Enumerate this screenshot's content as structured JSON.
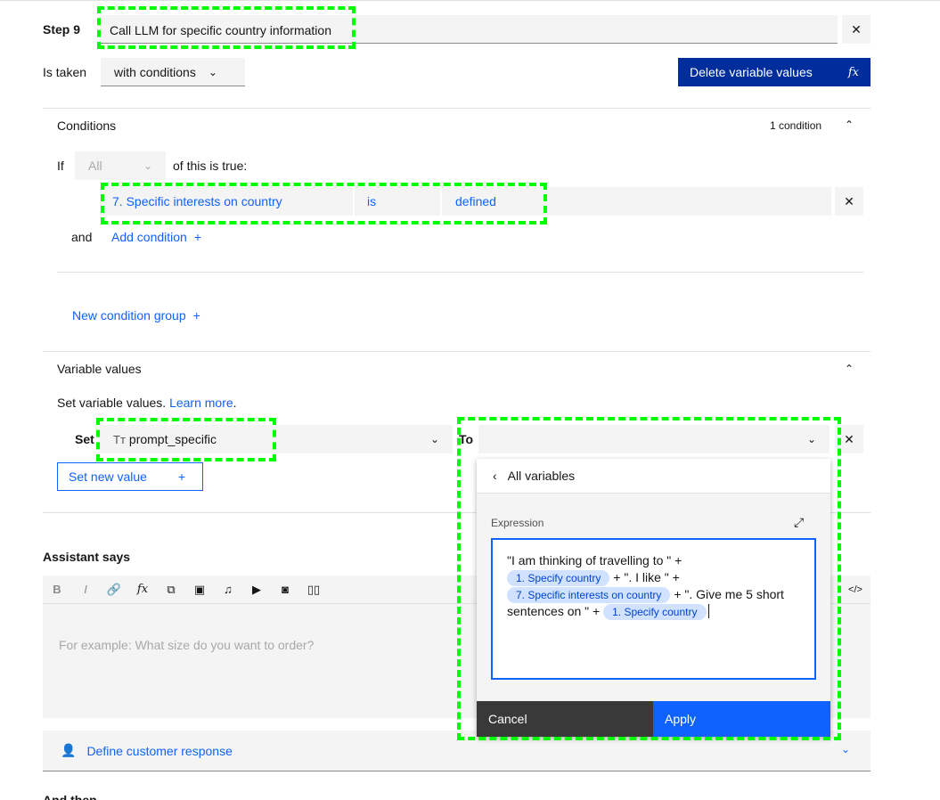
{
  "step": {
    "label": "Step 9",
    "title_value": "Call LLM for specific country information"
  },
  "taken": {
    "label": "Is taken",
    "value": "with conditions"
  },
  "delete_button": {
    "label": "Delete variable values",
    "icon_text": "fx"
  },
  "conditions": {
    "header": "Conditions",
    "count": "1 condition",
    "if_label": "If",
    "all_value": "All",
    "of_this": "of this is true:",
    "row": {
      "variable": "7. Specific interests on country",
      "operator": "is",
      "value": "defined"
    },
    "and_label": "and",
    "add_condition": "Add condition",
    "new_group": "New condition group"
  },
  "variables": {
    "header": "Variable values",
    "desc": "Set variable values.",
    "learn_more": "Learn more",
    "set_label": "Set",
    "set_type_icon": "Tт",
    "set_value": "prompt_specific",
    "to_label": "To",
    "set_new_value": "Set new value"
  },
  "popover": {
    "back_label": "All variables",
    "expression_label": "Expression",
    "line1": "\"I am thinking of travelling to \" +",
    "chip1": "1. Specify country",
    "text2": "+ \". I like \" +",
    "chip2": "7. Specific interests on country",
    "text3": "+ \". Give me 5 short",
    "text4": "sentences on \" +",
    "chip3": "1. Specify country",
    "cancel": "Cancel",
    "apply": "Apply"
  },
  "assistant": {
    "header": "Assistant says",
    "placeholder": "For example: What size do you want to order?"
  },
  "customer": {
    "label": "Define customer response"
  },
  "and_then": {
    "label": "And then"
  },
  "colors": {
    "primary": "#0f62fe",
    "dark_button": "#002d9c",
    "highlight": "#00ff00",
    "chip_bg": "#d0e2ff"
  }
}
